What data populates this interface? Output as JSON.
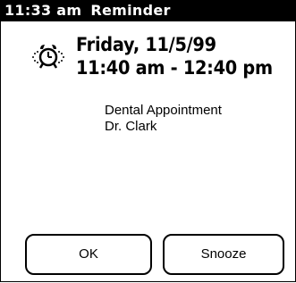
{
  "title_bar": {
    "time": "11:33 am",
    "title": "Reminder"
  },
  "alarm": {
    "icon": "alarm-clock-icon",
    "date": "Friday, 11/5/99",
    "time_range": "11:40 am - 12:40 pm"
  },
  "description": {
    "line1": "Dental Appointment",
    "line2": "Dr. Clark"
  },
  "buttons": {
    "ok_label": "OK",
    "snooze_label": "Snooze"
  }
}
